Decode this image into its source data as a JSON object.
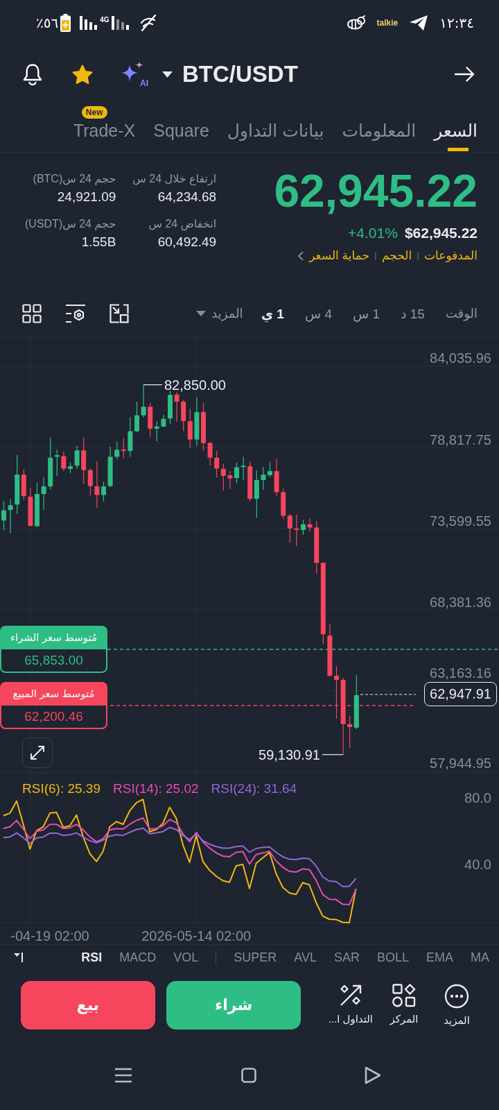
{
  "status_bar": {
    "battery": "٥٦٪",
    "network": "4G",
    "app_label": "talkie",
    "time": "١٢:٣٤"
  },
  "header": {
    "favorite": true,
    "ai_label": "AI",
    "pair": "BTC/USDT"
  },
  "tabs": [
    {
      "label": "السعر",
      "selected": true
    },
    {
      "label": "المعلومات",
      "selected": false
    },
    {
      "label": "بيانات التداول",
      "selected": false
    },
    {
      "label": "Square",
      "selected": false
    },
    {
      "label": "Trade-X",
      "selected": false,
      "badge": "New"
    }
  ],
  "ticker": {
    "last_price": "62,945.22",
    "usd_price": "$62,945.22",
    "change": "+4.01%",
    "tags": [
      "المدفوعات",
      "الحجم",
      "حماية السعر"
    ],
    "stats": [
      {
        "label": "ارتفاع خلال 24 س",
        "value": "64,234.68"
      },
      {
        "label": "حجم 24 س(BTC)",
        "value": "24,921.09"
      },
      {
        "label": "انخفاض 24 س",
        "value": "60,492.49"
      },
      {
        "label": "حجم 24 س(USDT)",
        "value": "1.55B"
      }
    ]
  },
  "interval_bar": {
    "caption": "الوقت",
    "options": [
      {
        "label": "15 د",
        "selected": false
      },
      {
        "label": "1 س",
        "selected": false
      },
      {
        "label": "4 س",
        "selected": false
      },
      {
        "label": "1 ي",
        "selected": true
      }
    ],
    "more": "المزيد"
  },
  "price_chart": {
    "y_labels": [
      "84,035.96",
      "78,817.75",
      "73,599.55",
      "68,381.36",
      "63,163.16",
      "57,944.95"
    ],
    "high": "82,850.00",
    "low": "59,130.91",
    "last": "62,947.91",
    "avg_buy": {
      "label": "مُتوسط سعر الشراء",
      "value": "65,853.00"
    },
    "avg_sell": {
      "label": "مُتوسط سعر المبيع",
      "value": "62,200.46"
    }
  },
  "rsi_panel": {
    "chart_data": {
      "type": "line",
      "categories": [
        null,
        null,
        null,
        null,
        null,
        null,
        null,
        "-04-19 02:00",
        null,
        null,
        null,
        null,
        null,
        null,
        null,
        null,
        null,
        null,
        null,
        null,
        null,
        null,
        null,
        null,
        null,
        null,
        null,
        null,
        null,
        "2026-05-14 02:00",
        null,
        null,
        null,
        null,
        null,
        null,
        null,
        null,
        null,
        null,
        null,
        null,
        null,
        null,
        null,
        null,
        null,
        null,
        null,
        null,
        null,
        null,
        null,
        null
      ],
      "ylim": [
        5,
        95
      ],
      "yticks": [
        {
          "value": 80,
          "label": "80.0"
        },
        {
          "value": 40,
          "label": "40.0"
        }
      ],
      "series": [
        {
          "name": "RSI(6): 25.39",
          "color": "#f0b90b",
          "values": [
            69.3,
            70.8,
            78.1,
            64.1,
            49.2,
            60.3,
            62.6,
            70.8,
            71.2,
            62.2,
            63.2,
            69.7,
            56.5,
            46.5,
            41.7,
            47.9,
            62.6,
            65.7,
            64.1,
            72.2,
            77.0,
            79.1,
            59.7,
            60.9,
            64.7,
            74.3,
            67.6,
            51.7,
            41.2,
            57.4,
            41.7,
            36.4,
            32.9,
            30.2,
            29.3,
            39.2,
            40.0,
            25.5,
            40.6,
            44.0,
            47.3,
            34.5,
            26.2,
            22.8,
            22.0,
            29.1,
            27.7,
            17.2,
            9.0,
            7.1,
            6.9,
            5.2,
            5.0,
            25.4
          ]
        },
        {
          "name": "RSI(14): 25.02",
          "color": "#e84cb3",
          "values": [
            61.6,
            62.6,
            66.4,
            61.3,
            55.5,
            59.9,
            60.7,
            64.1,
            64.1,
            61.6,
            62.0,
            64.1,
            60.7,
            56.5,
            53.6,
            55.5,
            60.7,
            61.6,
            61.3,
            64.1,
            66.4,
            67.9,
            61.3,
            61.6,
            63.2,
            67.0,
            65.1,
            58.4,
            53.6,
            59.3,
            53.6,
            49.8,
            46.9,
            45.0,
            44.6,
            47.3,
            47.7,
            40.2,
            45.9,
            46.9,
            47.9,
            42.1,
            38.3,
            35.8,
            35.4,
            37.3,
            36.9,
            30.6,
            22.0,
            19.1,
            18.9,
            16.1,
            15.9,
            25.0
          ]
        },
        {
          "name": "RSI(24): 31.64",
          "color": "#9168d6",
          "values": [
            56.1,
            56.5,
            58.9,
            56.1,
            52.6,
            55.9,
            56.5,
            58.8,
            58.8,
            57.4,
            57.8,
            58.9,
            56.5,
            54.2,
            53.0,
            54.6,
            57.0,
            57.8,
            57.4,
            59.3,
            60.9,
            61.8,
            58.4,
            58.9,
            59.7,
            62.2,
            60.9,
            57.4,
            54.9,
            58.4,
            54.2,
            52.1,
            50.7,
            49.8,
            49.8,
            50.7,
            51.1,
            47.3,
            49.6,
            50.2,
            50.5,
            47.3,
            44.6,
            43.1,
            42.9,
            43.8,
            43.4,
            39.2,
            32.5,
            30.0,
            29.7,
            26.8,
            26.8,
            31.6
          ]
        }
      ]
    }
  },
  "indicator_groups": [
    {
      "items": [
        {
          "label": "MA",
          "selected": false
        },
        {
          "label": "EMA",
          "selected": false
        },
        {
          "label": "BOLL",
          "selected": false
        },
        {
          "label": "SAR",
          "selected": false
        },
        {
          "label": "AVL",
          "selected": false
        },
        {
          "label": "SUPER",
          "selected": false
        }
      ]
    },
    {
      "items": [
        {
          "label": "VOL",
          "selected": false
        },
        {
          "label": "MACD",
          "selected": false
        },
        {
          "label": "RSI",
          "selected": true
        }
      ]
    }
  ],
  "actions": {
    "tools": [
      {
        "kind": "more",
        "label": "المزيد"
      },
      {
        "kind": "position",
        "label": "المركز"
      },
      {
        "kind": "trade",
        "label": "التداول ا..."
      }
    ],
    "buy": "شراء",
    "sell": "بيع"
  }
}
